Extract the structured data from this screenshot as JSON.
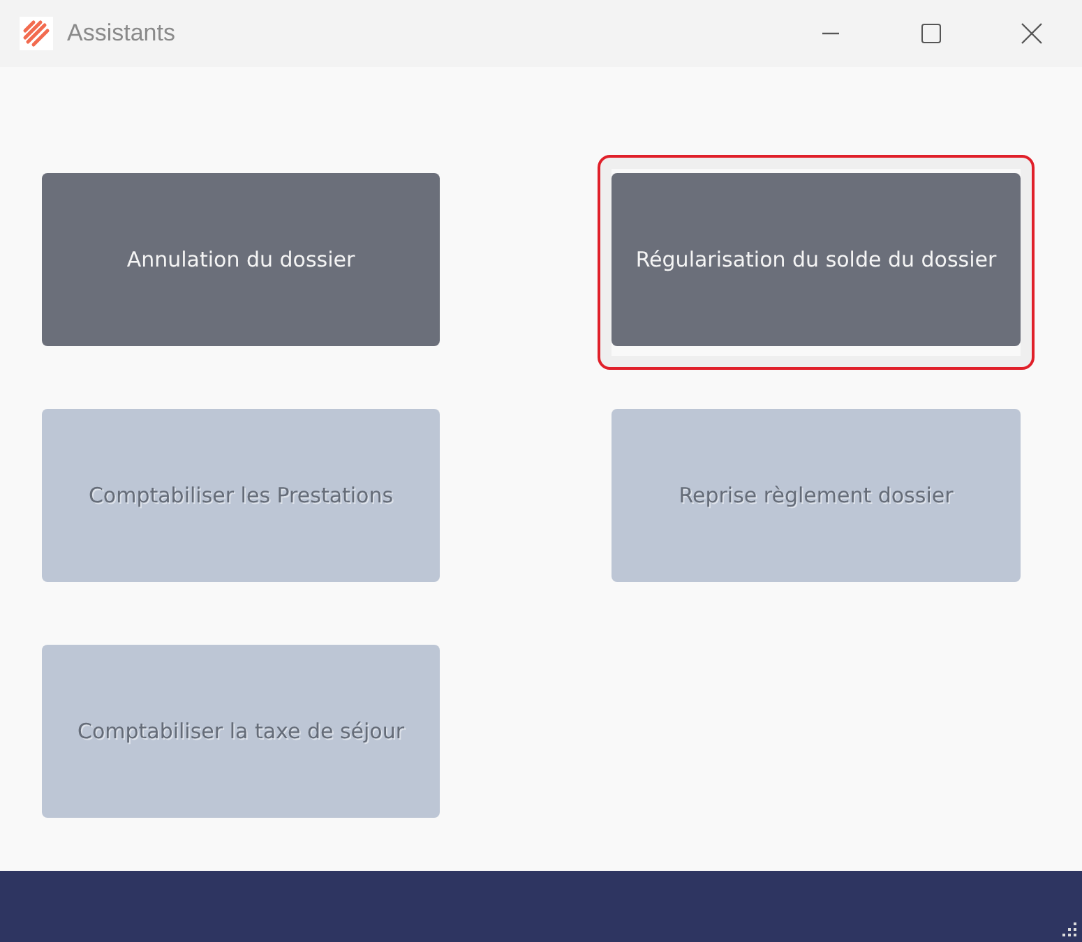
{
  "window": {
    "title": "Assistants"
  },
  "actions": [
    {
      "label": "Annulation du dossier",
      "disabled": false,
      "highlighted": false
    },
    {
      "label": "Régularisation du solde du dossier",
      "disabled": false,
      "highlighted": true
    },
    {
      "label": "Comptabiliser les Prestations",
      "disabled": true,
      "highlighted": false
    },
    {
      "label": "Reprise règlement dossier",
      "disabled": true,
      "highlighted": false
    },
    {
      "label": "Comptabiliser la taxe de séjour",
      "disabled": true,
      "highlighted": false
    }
  ]
}
